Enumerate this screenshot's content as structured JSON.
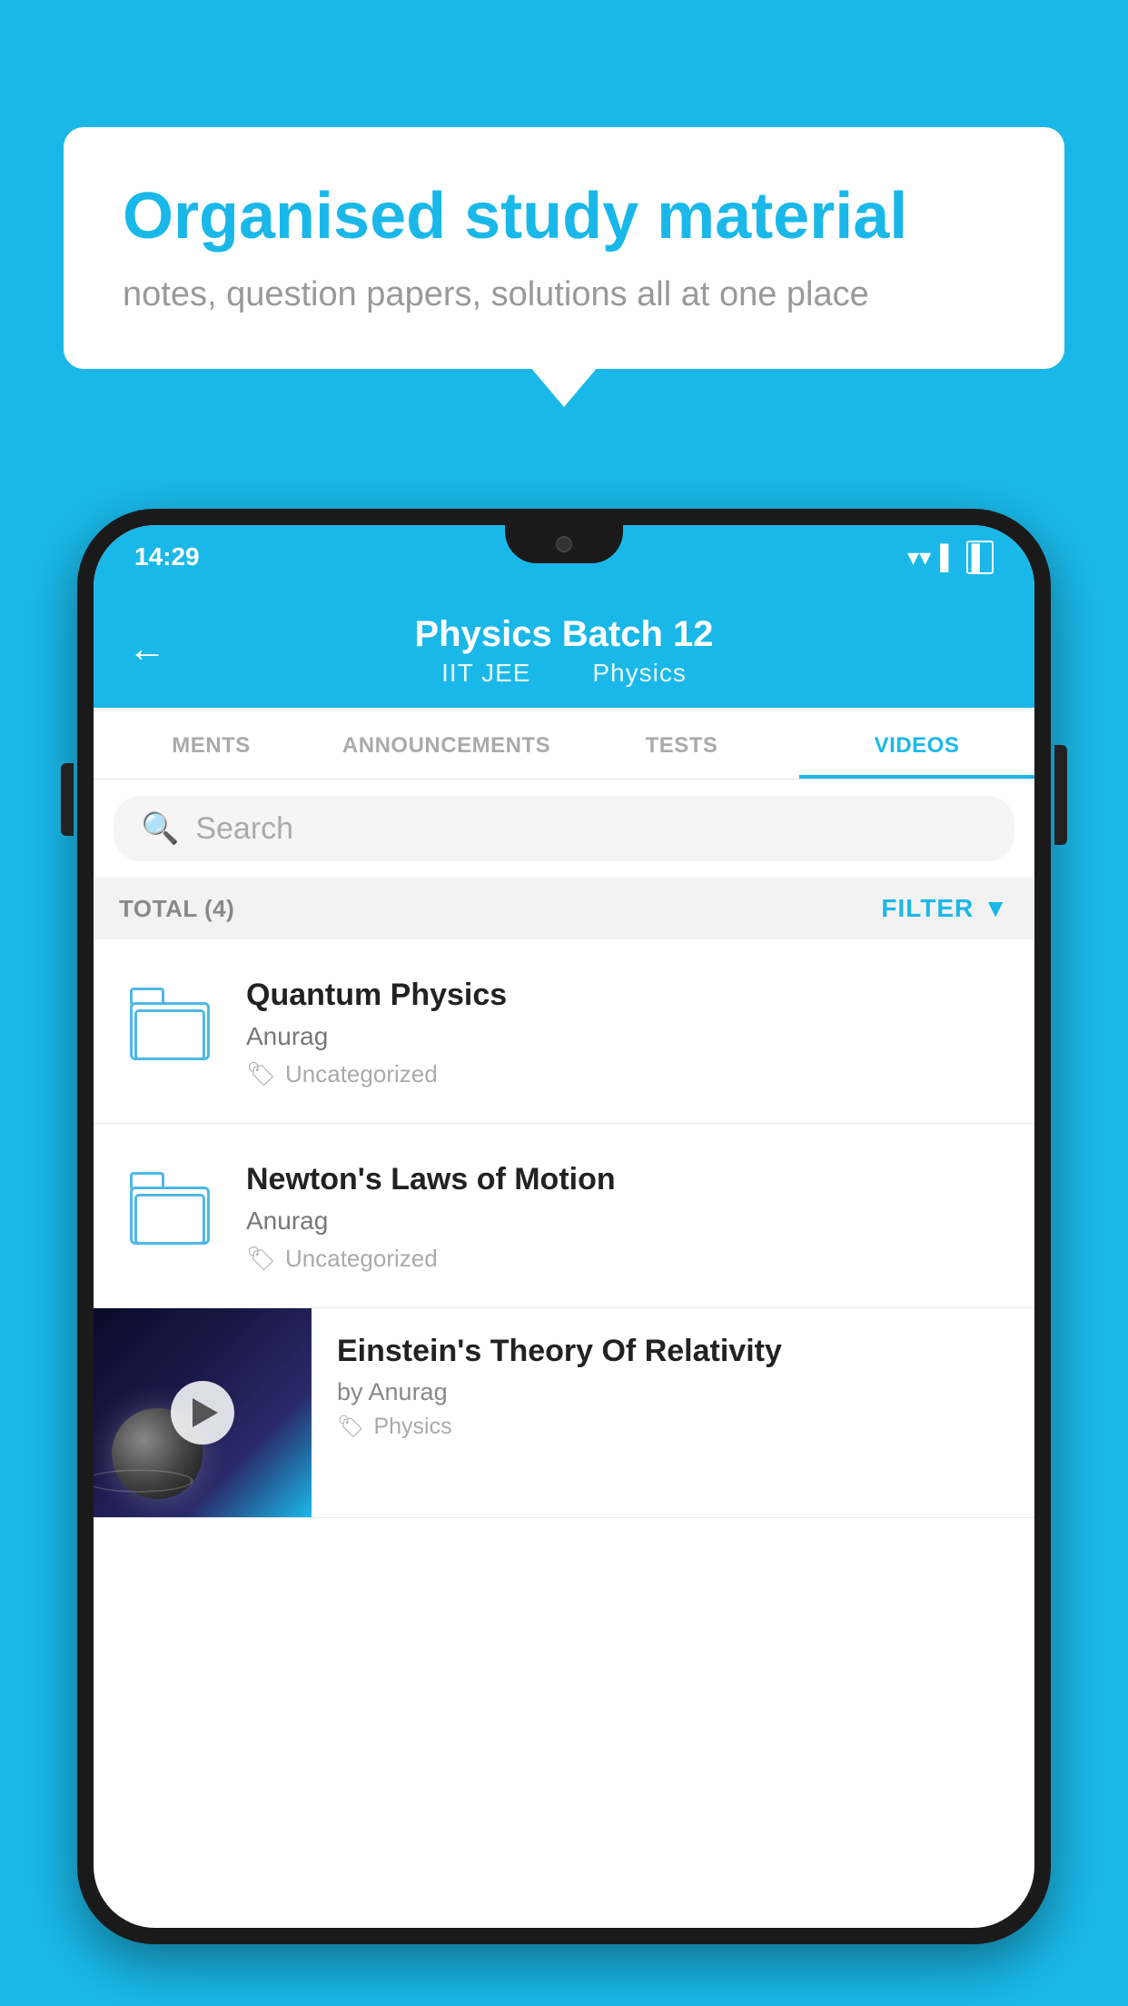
{
  "background_color": "#1ab8e8",
  "bubble": {
    "title": "Organised study material",
    "subtitle": "notes, question papers, solutions all at one place"
  },
  "status_bar": {
    "time": "14:29",
    "wifi": "▼",
    "signal": "◂",
    "battery": "▌"
  },
  "header": {
    "title": "Physics Batch 12",
    "tag1": "IIT JEE",
    "tag2": "Physics",
    "back_label": "←"
  },
  "tabs": [
    {
      "label": "MENTS",
      "active": false
    },
    {
      "label": "ANNOUNCEMENTS",
      "active": false
    },
    {
      "label": "TESTS",
      "active": false
    },
    {
      "label": "VIDEOS",
      "active": true
    }
  ],
  "search": {
    "placeholder": "Search"
  },
  "filter_bar": {
    "total_label": "TOTAL (4)",
    "filter_label": "FILTER"
  },
  "videos": [
    {
      "title": "Quantum Physics",
      "author": "Anurag",
      "tag": "Uncategorized",
      "has_thumbnail": false
    },
    {
      "title": "Newton's Laws of Motion",
      "author": "Anurag",
      "tag": "Uncategorized",
      "has_thumbnail": false
    },
    {
      "title": "Einstein's Theory Of Relativity",
      "author": "by Anurag",
      "tag": "Physics",
      "has_thumbnail": true
    }
  ]
}
